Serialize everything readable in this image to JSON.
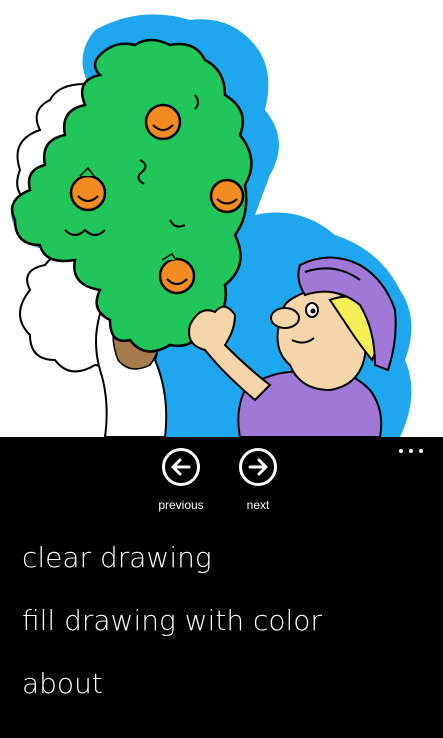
{
  "canvas": {
    "illustration": "orange-tree-picker-illustration"
  },
  "app_bar": {
    "more_icon": "ellipsis-icon",
    "buttons": [
      {
        "label": "previous",
        "icon": "arrow-left-icon"
      },
      {
        "label": "next",
        "icon": "arrow-right-icon"
      }
    ],
    "menu_items": [
      {
        "label": "clear drawing"
      },
      {
        "label": "fill drawing with color"
      },
      {
        "label": "about"
      }
    ]
  },
  "colors": {
    "background": "#000000",
    "foreground": "#ffffff",
    "sky_blue": "#1ea7ee",
    "leaf_green": "#21c65a",
    "orange": "#f28b21",
    "hat_purple": "#a078d8",
    "skin": "#f6d6a8",
    "hair_yellow": "#f4ef56",
    "trunk_brown": "#a67a4a"
  }
}
